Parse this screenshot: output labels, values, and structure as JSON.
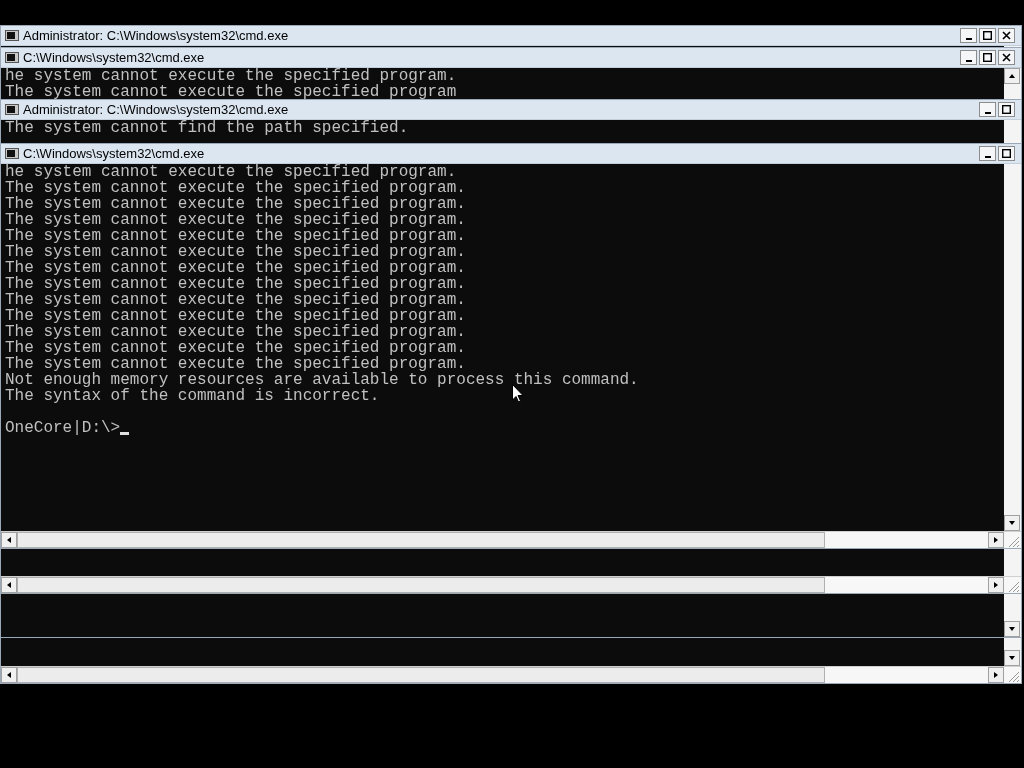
{
  "windows": [
    {
      "title": "Administrator: C:\\Windows\\system32\\cmd.exe",
      "controls": [
        {
          "kind": "minimize"
        },
        {
          "kind": "maximize"
        },
        {
          "kind": "close"
        }
      ],
      "scrollbars": [
        {
          "kind": "down"
        },
        {
          "kind": "horizontal"
        }
      ]
    },
    {
      "title": "C:\\Windows\\system32\\cmd.exe",
      "controls": [
        {
          "kind": "minimize"
        },
        {
          "kind": "maximize"
        },
        {
          "kind": "close"
        }
      ],
      "scrollbars": [
        {
          "kind": "up"
        },
        {
          "kind": "down"
        }
      ],
      "lines": [
        "he system cannot execute the specified program.",
        "The system cannot execute the specified program"
      ]
    },
    {
      "title": "Administrator: C:\\Windows\\system32\\cmd.exe",
      "controls": [
        {
          "kind": "minimize"
        },
        {
          "kind": "maximize"
        }
      ],
      "scrollbars": [
        {
          "kind": "horizontal"
        }
      ],
      "lines": [
        "The system cannot find the path specified."
      ]
    },
    {
      "title": "C:\\Windows\\system32\\cmd.exe",
      "controls": [
        {
          "kind": "minimize"
        },
        {
          "kind": "maximize"
        }
      ],
      "scrollbars": [
        {
          "kind": "down"
        },
        {
          "kind": "horizontal"
        }
      ],
      "lines": [
        "he system cannot execute the specified program.",
        "The system cannot execute the specified program.",
        "The system cannot execute the specified program.",
        "The system cannot execute the specified program.",
        "The system cannot execute the specified program.",
        "The system cannot execute the specified program.",
        "The system cannot execute the specified program.",
        "The system cannot execute the specified program.",
        "The system cannot execute the specified program.",
        "The system cannot execute the specified program.",
        "The system cannot execute the specified program.",
        "The system cannot execute the specified program.",
        "The system cannot execute the specified program.",
        "Not enough memory resources are available to process this command.",
        "The syntax of the command is incorrect."
      ],
      "prompt": "OneCore|D:\\>"
    }
  ]
}
